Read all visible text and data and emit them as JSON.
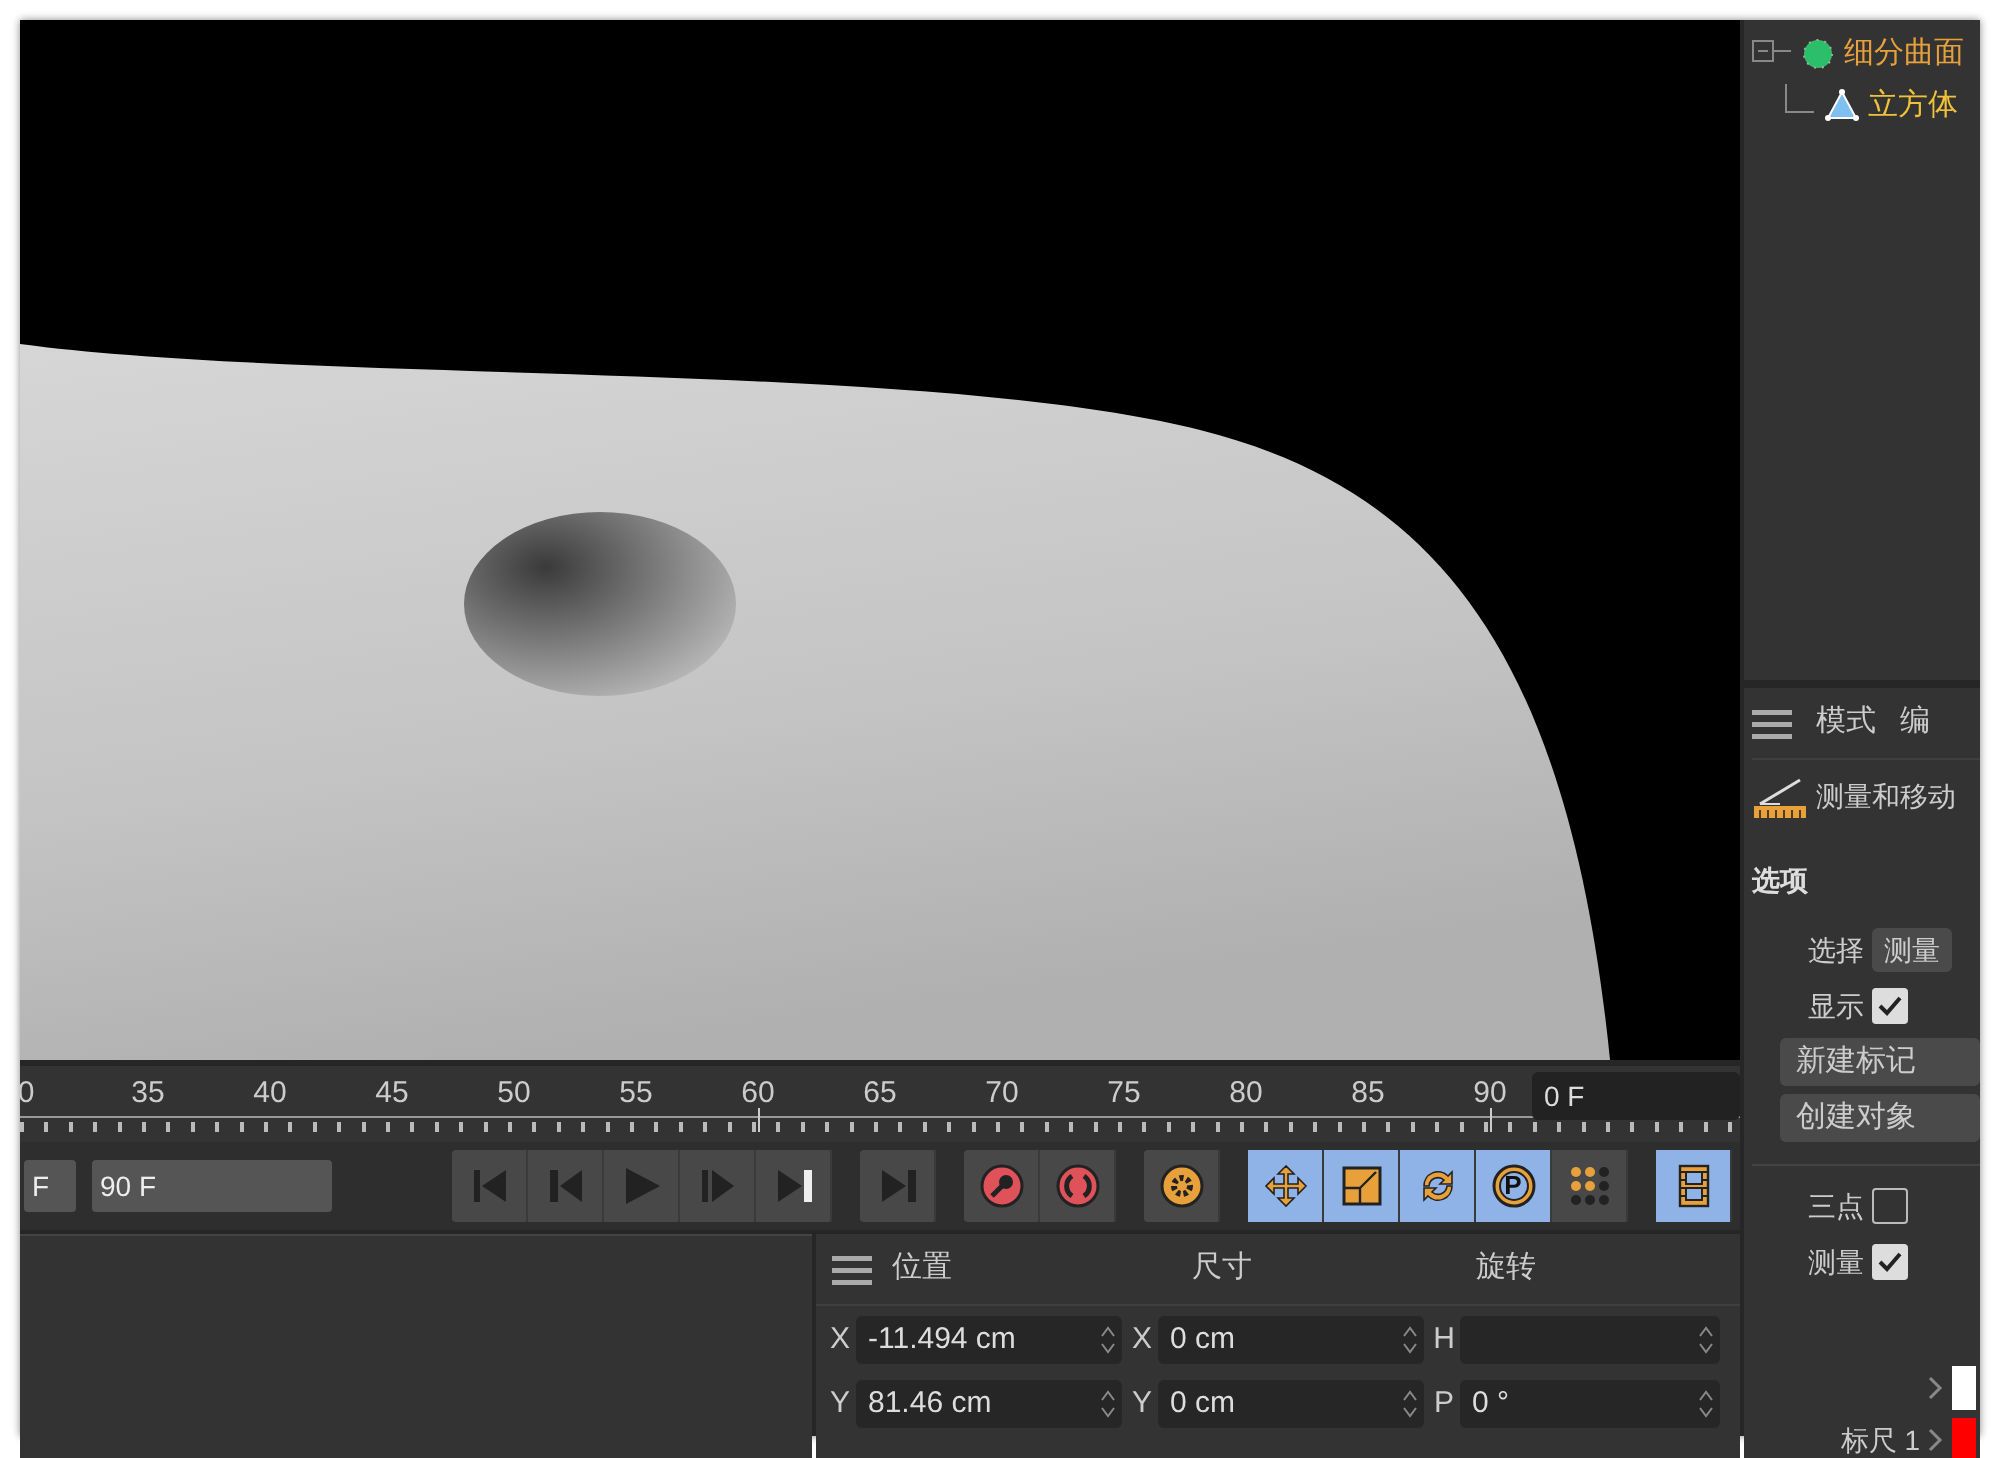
{
  "object_manager": {
    "objects": [
      {
        "name": "细分曲面",
        "kind": "subdivision",
        "children": [
          {
            "name": "立方体",
            "kind": "cube"
          }
        ]
      }
    ]
  },
  "timeline": {
    "ticks": [
      {
        "label": "0",
        "marked": false
      },
      {
        "label": "35",
        "marked": false
      },
      {
        "label": "40",
        "marked": false
      },
      {
        "label": "45",
        "marked": false
      },
      {
        "label": "50",
        "marked": false
      },
      {
        "label": "55",
        "marked": false
      },
      {
        "label": "60",
        "marked": true
      },
      {
        "label": "65",
        "marked": false
      },
      {
        "label": "70",
        "marked": false
      },
      {
        "label": "75",
        "marked": false
      },
      {
        "label": "80",
        "marked": false
      },
      {
        "label": "85",
        "marked": false
      },
      {
        "label": "90",
        "marked": true
      }
    ],
    "current_frame": "0 F"
  },
  "transport": {
    "range_fields": [
      "F",
      "90 F"
    ],
    "button_groups": [
      {
        "buttons": [
          {
            "kind": "goto-start",
            "selected": false
          },
          {
            "kind": "prev-key",
            "selected": false
          },
          {
            "kind": "play",
            "selected": false
          },
          {
            "kind": "next-frame",
            "selected": false
          },
          {
            "kind": "goto-end",
            "selected": false
          }
        ]
      },
      {
        "buttons": [
          {
            "kind": "last-key",
            "selected": false
          }
        ]
      },
      {
        "buttons": [
          {
            "kind": "record-key",
            "selected": false
          },
          {
            "kind": "autokey",
            "selected": false
          }
        ]
      },
      {
        "buttons": [
          {
            "kind": "keyframe-settings",
            "selected": false
          }
        ]
      },
      {
        "buttons": [
          {
            "kind": "move",
            "selected": true
          },
          {
            "kind": "scale",
            "selected": true
          },
          {
            "kind": "rotate",
            "selected": true
          },
          {
            "kind": "parameter",
            "selected": true,
            "label": "P"
          },
          {
            "kind": "dots",
            "selected": false
          }
        ]
      },
      {
        "buttons": [
          {
            "kind": "film",
            "selected": true
          }
        ]
      }
    ]
  },
  "attributes": {
    "menu": [
      "模式",
      "编"
    ],
    "tool_title": "测量和移动",
    "section": "选项",
    "rows": [
      {
        "kind": "dropdown",
        "label": "选择",
        "value": "测量"
      },
      {
        "kind": "checkbox",
        "label": "显示",
        "checked": true
      },
      {
        "kind": "button",
        "label": "新建标记"
      },
      {
        "kind": "button",
        "label": "创建对象"
      },
      {
        "kind": "separator"
      },
      {
        "kind": "checkbox",
        "label": "三点",
        "checked": false
      },
      {
        "kind": "checkbox",
        "label": "测量",
        "checked": true
      }
    ],
    "measures": [
      {
        "color": "#ffffff"
      },
      {
        "label": "标尺 1",
        "color": "#ff0000"
      }
    ]
  },
  "coordinates": {
    "headers": [
      "位置",
      "尺寸",
      "旋转"
    ],
    "rows": [
      {
        "fields": [
          {
            "axis": "X",
            "value": "-11.494 cm"
          },
          {
            "axis": "X",
            "value": "0 cm"
          },
          {
            "axis": "H"
          }
        ]
      },
      {
        "fields": [
          {
            "axis": "Y",
            "value": "81.46 cm"
          },
          {
            "axis": "Y",
            "value": "0 cm"
          },
          {
            "axis": "P",
            "value": "0 °"
          }
        ]
      }
    ]
  }
}
